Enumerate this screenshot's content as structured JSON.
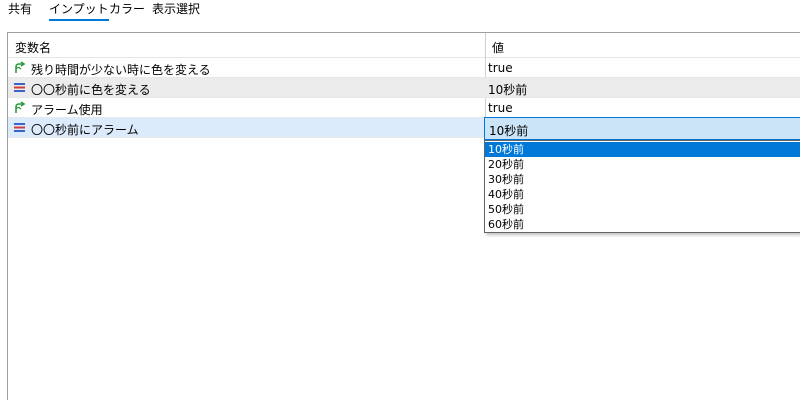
{
  "tabs": [
    {
      "label": "共有",
      "active": false
    },
    {
      "label": "インプット",
      "active": true
    },
    {
      "label": "カラー",
      "active": false
    },
    {
      "label": "表示選択",
      "active": false
    }
  ],
  "table": {
    "headers": {
      "name": "変数名",
      "value": "値"
    },
    "rows": [
      {
        "icon": "bool-arrow-icon",
        "name": "残り時間が少ない時に色を変える",
        "value": "true"
      },
      {
        "icon": "enum-list-icon",
        "name": "〇〇秒前に色を変える",
        "value": "10秒前"
      },
      {
        "icon": "bool-arrow-icon",
        "name": "アラーム使用",
        "value": "true"
      },
      {
        "icon": "enum-list-icon",
        "name": "〇〇秒前にアラーム",
        "value": "10秒前"
      }
    ]
  },
  "dropdown": {
    "selected_value": "10秒前",
    "options": [
      "10秒前",
      "20秒前",
      "30秒前",
      "40秒前",
      "50秒前",
      "60秒前"
    ],
    "highlighted": "10秒前"
  },
  "colors": {
    "accent": "#0078d7",
    "selection_bg": "#cce4f7",
    "row_selected": "#dcebfc",
    "row_shaded": "#ebebeb",
    "bool_icon": "#2e9a3e",
    "enum_icon_red": "#d23c3c",
    "enum_icon_blue": "#3c64c8"
  }
}
